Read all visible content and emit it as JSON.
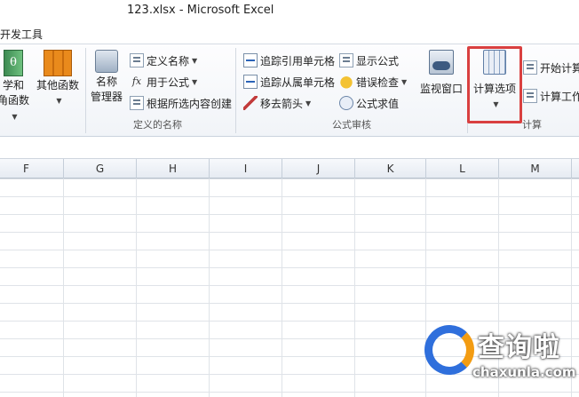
{
  "window": {
    "title": "123.xlsx  -  Microsoft Excel"
  },
  "tabs": {
    "developer": "开发工具"
  },
  "ribbon": {
    "math_func": {
      "line1": "学和",
      "line2": "角函数"
    },
    "other_func": {
      "label": "其他函数"
    },
    "name_manager": {
      "line1": "名称",
      "line2": "管理器"
    },
    "defined_names": {
      "define_name": "定义名称",
      "use_in_formula": "用于公式",
      "create_from_selection": "根据所选内容创建",
      "group_label": "定义的名称"
    },
    "formula_audit": {
      "trace_precedents": "追踪引用单元格",
      "trace_dependents": "追踪从属单元格",
      "remove_arrows": "移去箭头",
      "show_formulas": "显示公式",
      "error_checking": "错误检查",
      "evaluate_formula": "公式求值",
      "group_label": "公式审核"
    },
    "watch_window": {
      "label": "监视窗口"
    },
    "calculation": {
      "calc_options": "计算选项",
      "calc_now": "开始计算",
      "calc_sheet": "计算工作",
      "group_label": "计算"
    }
  },
  "columns": [
    "F",
    "G",
    "H",
    "I",
    "J",
    "K",
    "L",
    "M"
  ],
  "watermark": {
    "brand": "查询啦",
    "url": "chaxunla.com"
  },
  "colors": {
    "highlight": "#d94040",
    "ribbon_bg": "#f1f4f8"
  }
}
